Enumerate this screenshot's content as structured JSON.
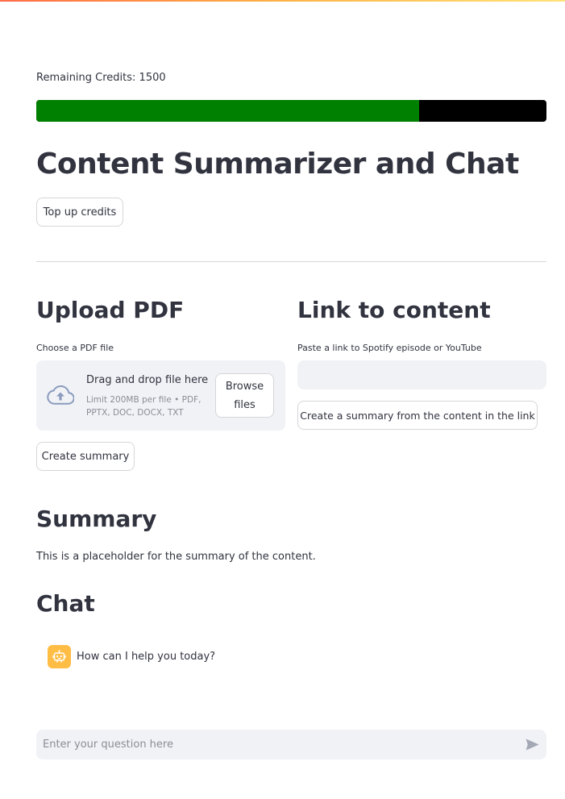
{
  "credits": {
    "label": "Remaining Credits: 1500",
    "progress_fraction": 0.75,
    "fill_color": "#008000",
    "track_color": "#000000"
  },
  "page": {
    "title": "Content Summarizer and Chat",
    "topup_label": "Top up credits"
  },
  "upload": {
    "heading": "Upload PDF",
    "field_label": "Choose a PDF file",
    "drop_title": "Drag and drop file here",
    "drop_limit": "Limit 200MB per file • PDF, PPTX, DOC, DOCX, TXT",
    "browse_label": "Browse files",
    "create_summary_label": "Create summary",
    "icon": "cloud-upload-icon"
  },
  "link": {
    "heading": "Link to content",
    "field_label": "Paste a link to Spotify episode or YouTube",
    "value": "",
    "button_label": "Create a summary from the content in the link"
  },
  "summary": {
    "heading": "Summary",
    "text": "This is a placeholder for the summary of the content."
  },
  "chat": {
    "heading": "Chat",
    "messages": [
      {
        "role": "assistant",
        "avatar_icon": "robot-icon",
        "avatar_color": "#ffbd45",
        "text": "How can I help you today?"
      }
    ],
    "input_placeholder": "Enter your question here",
    "send_icon": "send-icon"
  }
}
